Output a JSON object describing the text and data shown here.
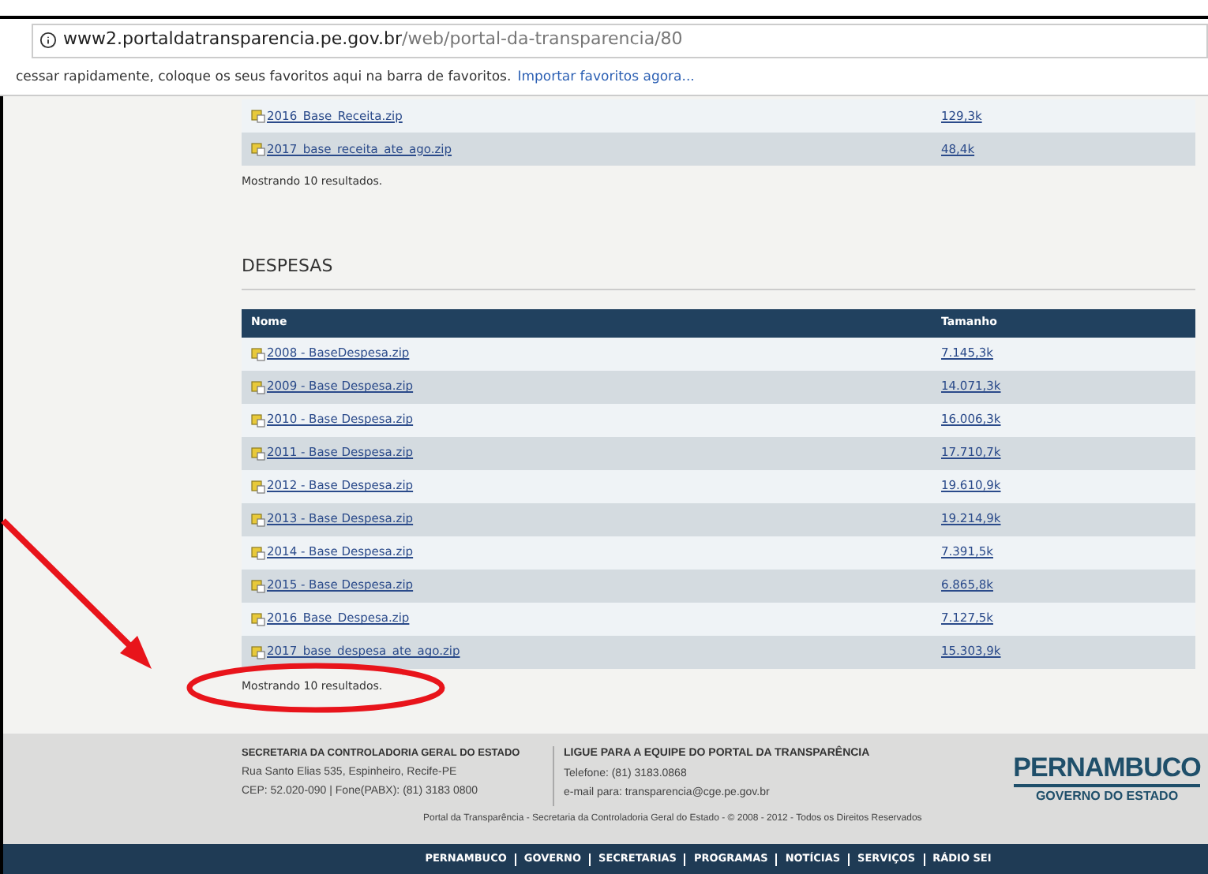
{
  "browser": {
    "url_host": "www2.portaldatransparencia.pe.gov.br",
    "url_path": "/web/portal-da-transparencia/80"
  },
  "bookmarks_bar": {
    "text": "cessar rapidamente, coloque os seus favoritos aqui na barra de favoritos.",
    "link": "Importar favoritos agora..."
  },
  "receita": {
    "rows": [
      {
        "name": "2016_Base_Receita.zip",
        "size": "129,3k"
      },
      {
        "name": "2017_base_receita_ate_ago.zip",
        "size": "48,4k"
      }
    ],
    "result_count": "Mostrando 10 resultados."
  },
  "despesas": {
    "title": "DESPESAS",
    "columns": [
      "Nome",
      "Tamanho"
    ],
    "rows": [
      {
        "name": "2008 - BaseDespesa.zip",
        "size": "7.145,3k"
      },
      {
        "name": "2009 - Base Despesa.zip",
        "size": "14.071,3k"
      },
      {
        "name": "2010 - Base Despesa.zip",
        "size": "16.006,3k"
      },
      {
        "name": "2011 - Base Despesa.zip",
        "size": "17.710,7k"
      },
      {
        "name": "2012 - Base Despesa.zip",
        "size": "19.610,9k"
      },
      {
        "name": "2013 - Base Despesa.zip",
        "size": "19.214,9k"
      },
      {
        "name": "2014 - Base Despesa.zip",
        "size": "7.391,5k"
      },
      {
        "name": "2015 - Base Despesa.zip",
        "size": "6.865,8k"
      },
      {
        "name": "2016_Base_Despesa.zip",
        "size": "7.127,5k"
      },
      {
        "name": "2017_base_despesa_ate_ago.zip",
        "size": "15.303,9k"
      }
    ],
    "result_count": "Mostrando 10 resultados."
  },
  "footer": {
    "left": {
      "heading": "SECRETARIA DA CONTROLADORIA GERAL DO ESTADO",
      "lines": [
        "Rua Santo Elias 535, Espinheiro, Recife-PE",
        "CEP: 52.020-090 | Fone(PABX): (81) 3183 0800"
      ]
    },
    "right": {
      "heading": "LIGUE PARA A EQUIPE DO PORTAL DA TRANSPARÊNCIA",
      "lines": [
        "Telefone: (81) 3183.0868",
        "e-mail para: transparencia@cge.pe.gov.br"
      ]
    },
    "logo": {
      "name": "PERNAMBUCO",
      "subtitle": "GOVERNO DO ESTADO"
    },
    "copyright": "Portal da Transparência - Secretaria da Controladoria Geral do Estado - © 2008 - 2012 - Todos os Direitos Reservados"
  },
  "nav": [
    "PERNAMBUCO",
    "GOVERNO",
    "SECRETARIAS",
    "PROGRAMAS",
    "NOTÍCIAS",
    "SERVIÇOS",
    "RÁDIO SEI"
  ]
}
